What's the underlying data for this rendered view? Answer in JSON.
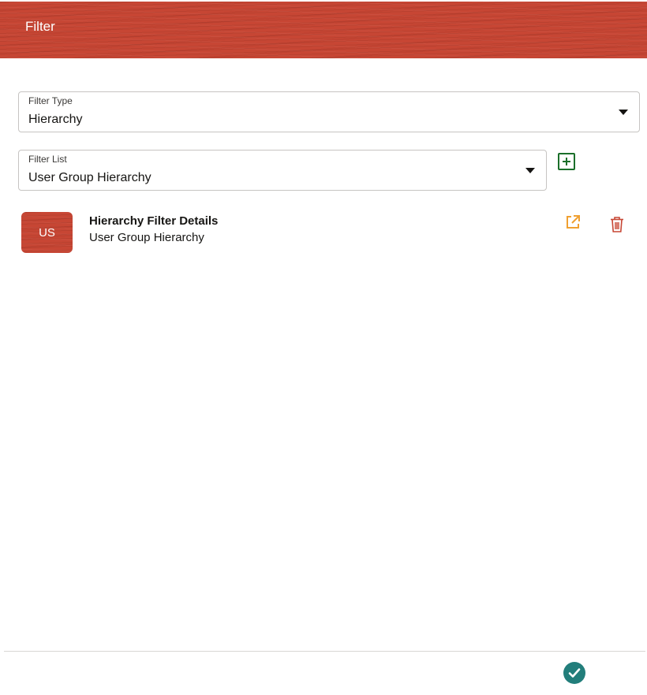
{
  "header": {
    "title": "Filter"
  },
  "filter_type": {
    "label": "Filter Type",
    "value": "Hierarchy"
  },
  "filter_list": {
    "label": "Filter List",
    "value": "User Group Hierarchy"
  },
  "filter_item": {
    "avatar_initials": "US",
    "title": "Hierarchy Filter Details",
    "subtitle": "User Group Hierarchy"
  },
  "icons": {
    "add": "add-box-icon",
    "edit": "open-external-icon",
    "delete": "trash-icon",
    "confirm": "checkmark-icon"
  },
  "colors": {
    "brand": "#c74634",
    "add": "#1b6f2a",
    "edit": "#f0a031",
    "delete": "#c74634",
    "confirm": "#227e7b"
  }
}
